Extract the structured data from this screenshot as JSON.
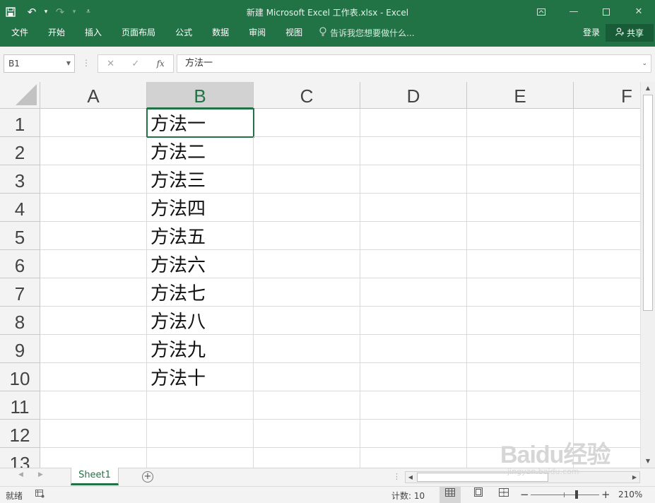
{
  "window": {
    "title": "新建 Microsoft Excel 工作表.xlsx - Excel",
    "qat": {
      "save_icon": "save-icon",
      "undo_icon": "undo-icon",
      "redo_icon": "redo-icon",
      "customize_icon": "customize-qat-icon"
    },
    "controls": {
      "ribbon_display": "ribbon-display-icon",
      "minimize": "minimize-icon",
      "maximize": "maximize-icon",
      "close": "close-icon"
    }
  },
  "ribbon": {
    "tabs": [
      "文件",
      "开始",
      "插入",
      "页面布局",
      "公式",
      "数据",
      "审阅",
      "视图"
    ],
    "tell_me": "告诉我您想要做什么...",
    "sign_in": "登录",
    "share": "共享"
  },
  "formula_bar": {
    "name_box": "B1",
    "fx": "fx",
    "content": "方法一"
  },
  "grid": {
    "columns": [
      "A",
      "B",
      "C",
      "D",
      "E",
      "F"
    ],
    "rows": [
      "1",
      "2",
      "3",
      "4",
      "5",
      "6",
      "7",
      "8",
      "9",
      "10",
      "11",
      "12",
      "13"
    ],
    "selected_cell": "B1",
    "column_b_values": [
      "方法一",
      "方法二",
      "方法三",
      "方法四",
      "方法五",
      "方法六",
      "方法七",
      "方法八",
      "方法九",
      "方法十"
    ]
  },
  "sheets": {
    "tabs": [
      "Sheet1"
    ],
    "active": "Sheet1",
    "add": "+"
  },
  "status": {
    "ready": "就绪",
    "count": "计数: 10",
    "zoom": "210%"
  },
  "colors": {
    "accent": "#217346",
    "accent_dark": "#185c37",
    "chrome": "#f3f3f3"
  },
  "watermark": {
    "logo": "Baidu经验",
    "sub": "jingyan.baidu.com"
  }
}
